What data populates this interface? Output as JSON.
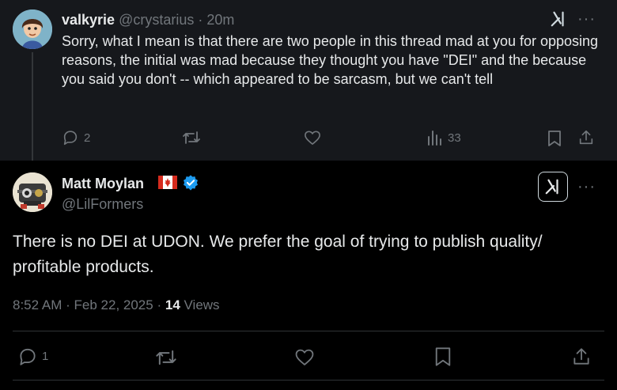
{
  "reply": {
    "author_name": "valkyrie",
    "author_handle": "@crystarius",
    "separator": "·",
    "time": "20m",
    "text": "Sorry, what I mean is that there are two people in this thread mad at you for opposing reasons, the initial was mad because they thought you have \"DEI\" and the because you said you don't -- which appeared to be sarcasm, but we can't tell",
    "reply_count": "2",
    "view_count": "33"
  },
  "main": {
    "author_name": "Matt Moylan",
    "author_handle": "@LilFormers",
    "text": "There is no DEI at UDON. We prefer the goal of trying to publish quality/ profitable products.",
    "time": "8:52 AM",
    "date": "Feb 22, 2025",
    "dot": "·",
    "views_count": "14",
    "views_label": "Views",
    "reply_count": "1"
  },
  "colors": {
    "background": "#000000",
    "reply_background": "#16181c",
    "text": "#e7e9ea",
    "muted": "#71767b",
    "verified": "#1d9bf0",
    "divider": "#2f3336"
  },
  "icons": {
    "reply": "speech-bubble-icon",
    "retweet": "repost-arrows-icon",
    "like": "heart-icon",
    "views": "bar-chart-icon",
    "bookmark": "bookmark-icon",
    "share": "upload-share-icon",
    "grok": "grok-icon",
    "more": "more-dots-icon",
    "verified": "verified-badge-icon",
    "flag": "canada-flag-icon"
  }
}
